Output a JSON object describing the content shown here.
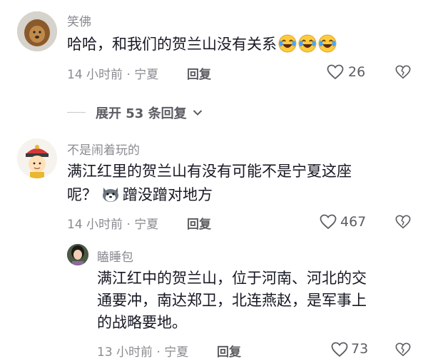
{
  "comments": [
    {
      "username": "笑佛",
      "text": "哈哈，和我们的贺兰山没有关系",
      "emojis": [
        "laughing-tears-emoji",
        "laughing-tears-emoji",
        "laughing-tears-emoji"
      ],
      "time_location": "14 小时前 · 宁夏",
      "reply_label": "回复",
      "likes": "26",
      "expand_label": "展开 53 条回复"
    },
    {
      "username": "不是闹着玩的",
      "text_line1": "满江红里的贺兰山有没有可能不是宁夏这座",
      "text_line2_a": "呢？",
      "text_line2_b": "蹭没蹭对地方",
      "emoji": "husky-emoji",
      "time_location": "14 小时前 · 宁夏",
      "reply_label": "回复",
      "likes": "467",
      "replies": [
        {
          "username": "瞌睡包",
          "text_line1": "满江红中的贺兰山，位于河南、河北的交",
          "text_line2": "通要冲，南达郑卫，北连燕赵，是军事上",
          "text_line3": "的战略要地。",
          "time_location": "13 小时前 · 宁夏",
          "reply_label": "回复",
          "likes": "73"
        }
      ]
    }
  ],
  "colors": {
    "text": "#161823",
    "secondary": "#8a8b91",
    "icon": "#5c5d63"
  }
}
